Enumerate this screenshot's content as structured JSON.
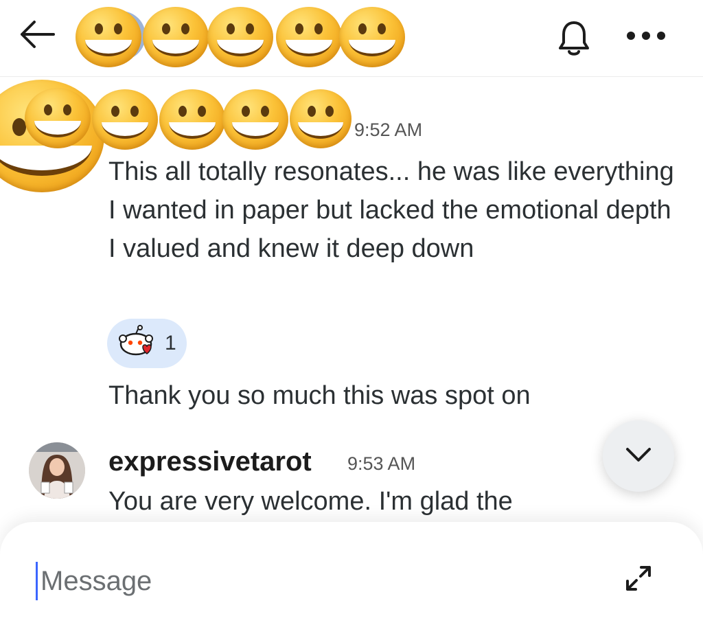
{
  "header": {
    "title": "",
    "icons": {
      "back": "back-arrow-icon",
      "bell": "bell-icon",
      "more": "more-dots-icon"
    }
  },
  "messages": [
    {
      "sender": "",
      "time": "9:52 AM",
      "body": "This all totally resonates... he was like everything I wanted in paper but lacked the emotional depth I valued and knew it deep down",
      "reaction": {
        "icon": "snoo-heart-icon",
        "count": "1"
      }
    },
    {
      "body": "Thank you so much this was spot on"
    },
    {
      "sender": "expressivetarot",
      "time": "9:53 AM",
      "body": "You are very welcome. I'm glad the"
    }
  ],
  "composer": {
    "placeholder": "Message",
    "value": "",
    "expand_icon": "expand-arrows-icon"
  },
  "scroll_button_icon": "chevron-down-icon",
  "colors": {
    "reaction_bg": "#dce9fb",
    "cursor": "#3b66ff",
    "emoji": "#fbc238"
  }
}
